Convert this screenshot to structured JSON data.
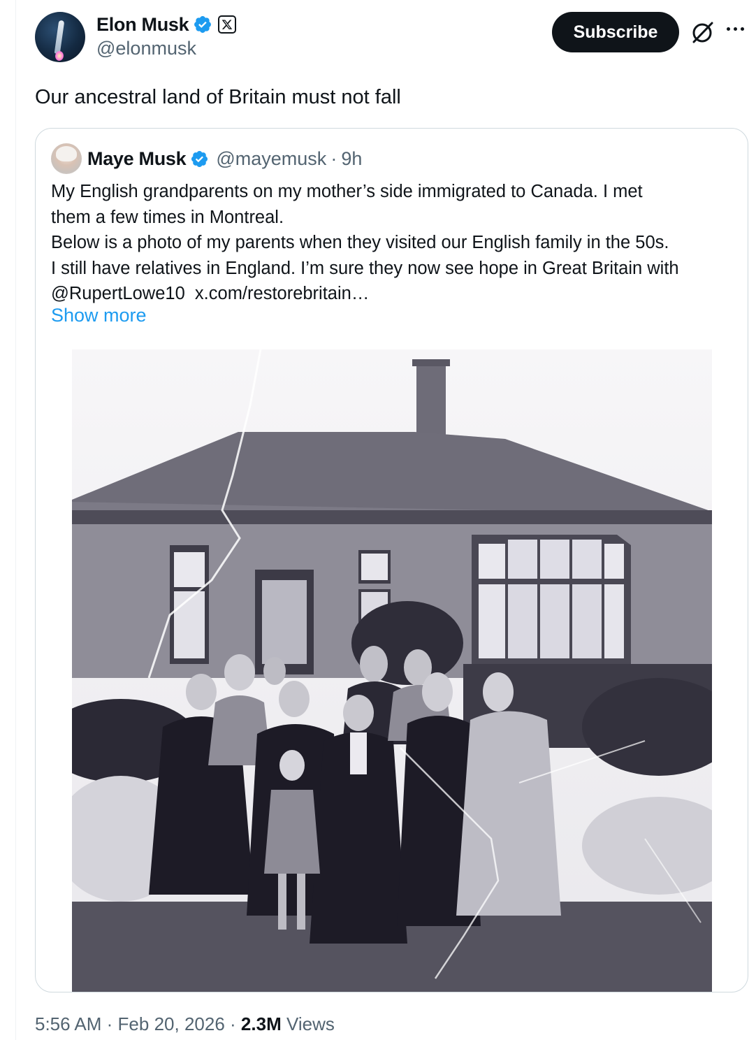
{
  "author": {
    "display_name": "Elon Musk",
    "handle": "@elonmusk"
  },
  "actions": {
    "subscribe_label": "Subscribe"
  },
  "tweet": {
    "text": "Our ancestral land of Britain must not fall"
  },
  "quoted": {
    "display_name": "Maye Musk",
    "handle": "@mayemusk",
    "separator": "·",
    "time": "9h",
    "lines": [
      "My English grandparents on my mother’s side immigrated to Canada. I met",
      "them a few times in Montreal.",
      "Below is a photo of my parents when they visited our English family in the 50s.",
      "I still have relatives in England. I’m sure they now see hope in Great Britain with"
    ],
    "mention": "@RupertLowe10",
    "link": "x.com/restorebritain…",
    "show_more": "Show more"
  },
  "meta": {
    "time": "5:56 AM",
    "sep1": "·",
    "date": "Feb 20, 2026",
    "sep2": "·",
    "views_count": "2.3M",
    "views_label": "Views"
  },
  "colors": {
    "link": "#1d9bf0",
    "verified": "#1d9bf0",
    "secondary_text": "#536471",
    "button_bg": "#0f1419"
  },
  "icons": [
    "verified-badge-icon",
    "x-logo-icon",
    "grok-icon",
    "more-options-icon"
  ]
}
